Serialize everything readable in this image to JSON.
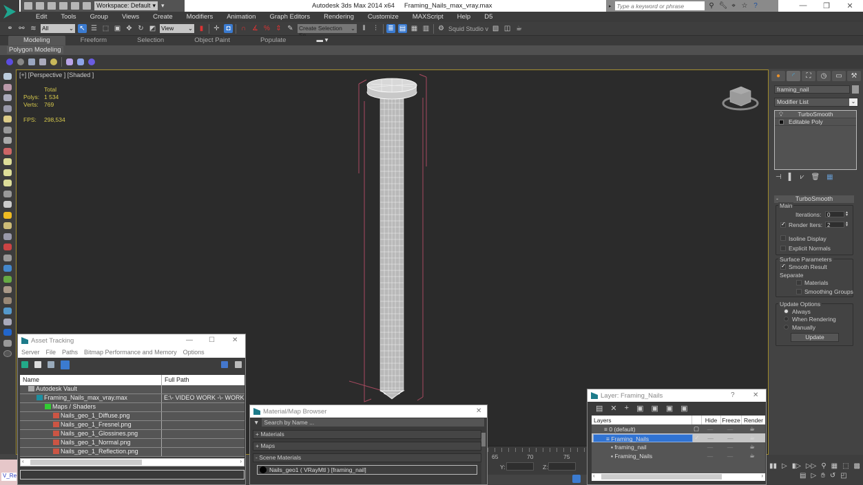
{
  "window": {
    "app_title": "Autodesk 3ds Max  2014 x64",
    "file_title": "Framing_Nails_max_vray.max",
    "workspace": "Workspace: Default",
    "search_placeholder": "Type a keyword or phrase",
    "controls": {
      "minimize": "—",
      "restore": "❐",
      "close": "✕"
    }
  },
  "menu": [
    "Edit",
    "Tools",
    "Group",
    "Views",
    "Create",
    "Modifiers",
    "Animation",
    "Graph Editors",
    "Rendering",
    "Customize",
    "MAXScript",
    "Help",
    "D5"
  ],
  "toolbar": {
    "selection_filter": "All",
    "reference_coord": "View",
    "named_selection_placeholder": "Create Selection Se",
    "squid_label": "Squid Studio v"
  },
  "ribbon": {
    "tabs": [
      "Modeling",
      "Freeform",
      "Selection",
      "Object Paint",
      "Populate"
    ],
    "active_tab": "Modeling",
    "panel_label": "Polygon Modeling"
  },
  "viewport": {
    "label": "[+] [Perspective ] [Shaded ]",
    "stats": {
      "header": "Total",
      "polys_label": "Polys:",
      "polys": "1 534",
      "verts_label": "Verts:",
      "verts": "769",
      "fps_label": "FPS:",
      "fps": "298,534"
    }
  },
  "command_panel": {
    "object_name": "framing_nail",
    "modifier_list": "Modifier List",
    "stack": [
      "TurboSmooth",
      "Editable Poly"
    ],
    "rollout_title": "TurboSmooth",
    "main_group": "Main",
    "iterations_label": "Iterations:",
    "iterations": "0",
    "render_iters_label": "Render Iters:",
    "render_iters": "2",
    "render_iters_checked": true,
    "isoline_label": "Isoline Display",
    "isoline_checked": false,
    "explicit_normals_label": "Explicit Normals",
    "explicit_normals_checked": false,
    "surface_group": "Surface Parameters",
    "smooth_result_label": "Smooth Result",
    "smooth_result_checked": true,
    "separate_label": "Separate",
    "materials_label": "Materials",
    "materials_checked": false,
    "smoothing_groups_label": "Smoothing Groups",
    "smoothing_groups_checked": false,
    "update_group": "Update Options",
    "update_options": [
      "Always",
      "When Rendering",
      "Manually"
    ],
    "update_selected": "Always",
    "update_button": "Update"
  },
  "asset_tracking": {
    "title": "Asset Tracking",
    "menu": [
      "Server",
      "File",
      "Paths",
      "Bitmap Performance and Memory",
      "Options"
    ],
    "columns": [
      "Name",
      "Full Path"
    ],
    "rows": [
      {
        "name": "Autodesk Vault",
        "path": "",
        "indent": 1,
        "icon": "vault"
      },
      {
        "name": "Framing_Nails_max_vray.max",
        "path": "E:\\- VIDEO WORK -\\- WORK",
        "indent": 2,
        "icon": "max"
      },
      {
        "name": "Maps / Shaders",
        "path": "",
        "indent": 3,
        "icon": "maps"
      },
      {
        "name": "Nails_geo_1_Diffuse.png",
        "path": "",
        "indent": 4,
        "icon": "png"
      },
      {
        "name": "Nails_geo_1_Fresnel.png",
        "path": "",
        "indent": 4,
        "icon": "png"
      },
      {
        "name": "Nails_geo_1_Glossines.png",
        "path": "",
        "indent": 4,
        "icon": "png"
      },
      {
        "name": "Nails_geo_1_Normal.png",
        "path": "",
        "indent": 4,
        "icon": "png"
      },
      {
        "name": "Nails_geo_1_Reflection.png",
        "path": "",
        "indent": 4,
        "icon": "png"
      }
    ]
  },
  "material_browser": {
    "title": "Material/Map Browser",
    "search_placeholder": "Search by Name ...",
    "sections": [
      "+ Materials",
      "+ Maps",
      "- Scene Materials"
    ],
    "scene_material": "Nails_geo1  ( VRayMtl )  [framing_nail]"
  },
  "layer_dialog": {
    "title": "Layer: Framing_Nails",
    "help": "?",
    "columns": [
      "Layers",
      "Hide",
      "Freeze",
      "Render"
    ],
    "rows": [
      {
        "name": "0 (default)",
        "selected": false,
        "active": false
      },
      {
        "name": "Framing_Nails",
        "selected": true,
        "active": true
      },
      {
        "name": "framing_nail",
        "selected": false,
        "active": false
      },
      {
        "name": "Framing_Nails",
        "selected": false,
        "active": false
      }
    ]
  },
  "timeline": {
    "ticks": [
      "65",
      "70",
      "75"
    ]
  },
  "coords": {
    "y_label": "Y:",
    "z_label": "Z:"
  },
  "maxscript": {
    "label": "V_Re"
  },
  "colors": {
    "accent": "#3073d3",
    "viewport_border": "#a08a2a",
    "stats": "#d6c84c",
    "wire_bbox": "#c0506a"
  }
}
